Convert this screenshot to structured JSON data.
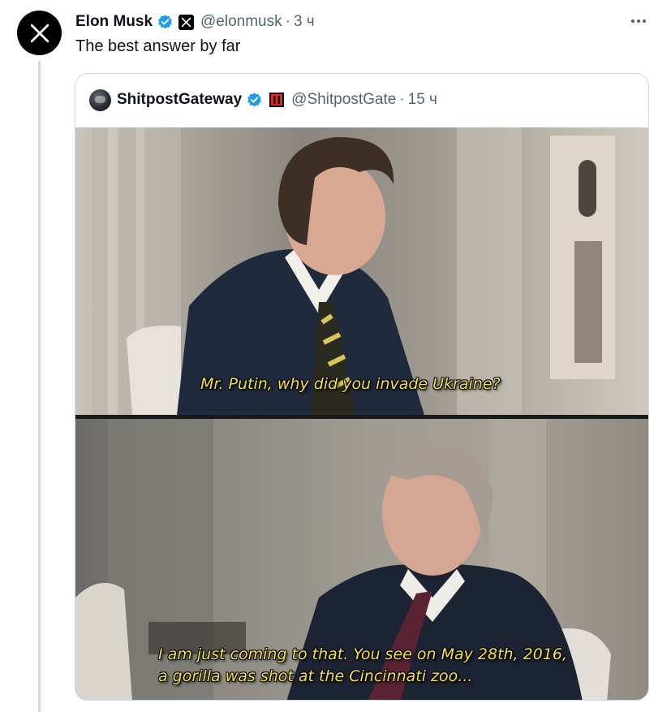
{
  "tweet": {
    "author_name": "Elon Musk",
    "handle": "@elonmusk",
    "separator": "·",
    "time": "3 ч",
    "text": "The best answer by far",
    "avatar_icon": "x-logo-icon",
    "verified_color": "#1d9bf0"
  },
  "quote": {
    "author_name": "ShitpostGateway",
    "handle": "@ShitpostGate",
    "separator": "·",
    "time": "15 ч"
  },
  "meme": {
    "caption_top": "Mr. Putin, why did you invade Ukraine?",
    "caption_bottom_line1": "I am just coming to that. You see on May 28th, 2016,",
    "caption_bottom_line2": "a gorilla was shot at the Cincinnati zoo...",
    "caption_color": "#f2e24a"
  }
}
